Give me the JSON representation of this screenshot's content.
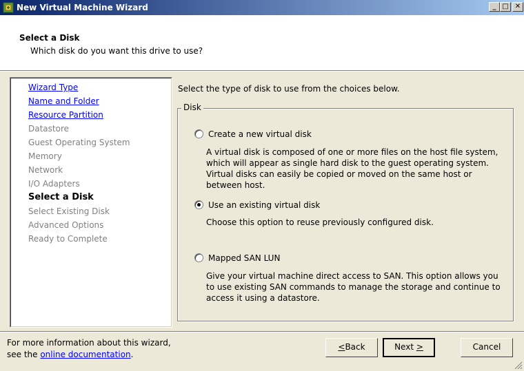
{
  "window": {
    "title": "New Virtual Machine Wizard",
    "minimize": "_",
    "maximize": "□",
    "close": "✕"
  },
  "header": {
    "title": "Select a Disk",
    "subtitle": "Which disk do you want this drive to use?"
  },
  "nav": {
    "items": [
      {
        "label": "Wizard Type",
        "state": "link"
      },
      {
        "label": "Name and Folder",
        "state": "link"
      },
      {
        "label": "Resource Partition",
        "state": "link"
      },
      {
        "label": "Datastore",
        "state": "disabled"
      },
      {
        "label": "Guest Operating System",
        "state": "disabled"
      },
      {
        "label": "Memory",
        "state": "disabled"
      },
      {
        "label": "Network",
        "state": "disabled"
      },
      {
        "label": "I/O Adapters",
        "state": "disabled"
      },
      {
        "label": "Select a Disk",
        "state": "current"
      },
      {
        "label": "Select Existing Disk",
        "state": "disabled"
      },
      {
        "label": "Advanced Options",
        "state": "disabled"
      },
      {
        "label": "Ready to Complete",
        "state": "disabled"
      }
    ]
  },
  "main": {
    "intro": "Select the type of disk to use from the choices below.",
    "group_label": "Disk",
    "options": [
      {
        "label": "Create a new virtual disk",
        "checked": false,
        "description": "A virtual disk is composed of one or more files on the host file system, which will appear as single hard disk to the guest operating system. Virtual disks can easily be copied or moved on the same host or between host."
      },
      {
        "label": "Use an existing virtual disk",
        "checked": true,
        "description": "Choose this option to reuse previously configured disk."
      },
      {
        "label": "Mapped SAN LUN",
        "checked": false,
        "description": "Give your virtual machine direct access to SAN. This option allows you to use existing SAN commands to manage the storage and continue to access it using a datastore."
      }
    ]
  },
  "footer": {
    "info_line1": "For more information about this wizard,",
    "info_line2_prefix": "see the ",
    "info_link": "online documentation",
    "info_line2_suffix": ".",
    "back_key": "<",
    "back_rest": "Back",
    "next_label": "Next ",
    "next_key": ">",
    "cancel_label": "Cancel"
  }
}
